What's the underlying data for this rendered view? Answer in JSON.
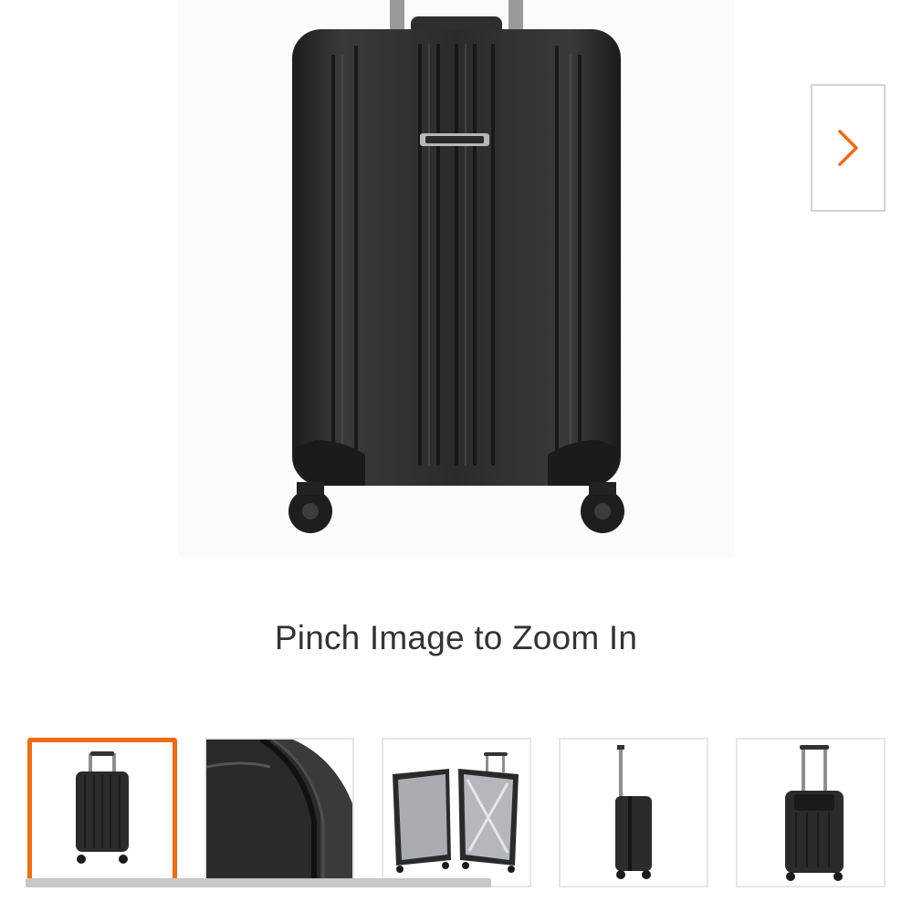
{
  "product_gallery": {
    "main_image_alt": "Black hardside spinner carry-on suitcase",
    "next_icon": "chevron-right-icon",
    "zoom_hint": "Pinch Image to Zoom In",
    "accent_color": "#f26b10",
    "thumbnails": [
      {
        "alt": "Suitcase front view",
        "selected": true
      },
      {
        "alt": "Suitcase zipper detail",
        "selected": false
      },
      {
        "alt": "Suitcase open interior",
        "selected": false
      },
      {
        "alt": "Suitcase side view",
        "selected": false
      },
      {
        "alt": "Suitcase back view",
        "selected": false
      }
    ]
  }
}
